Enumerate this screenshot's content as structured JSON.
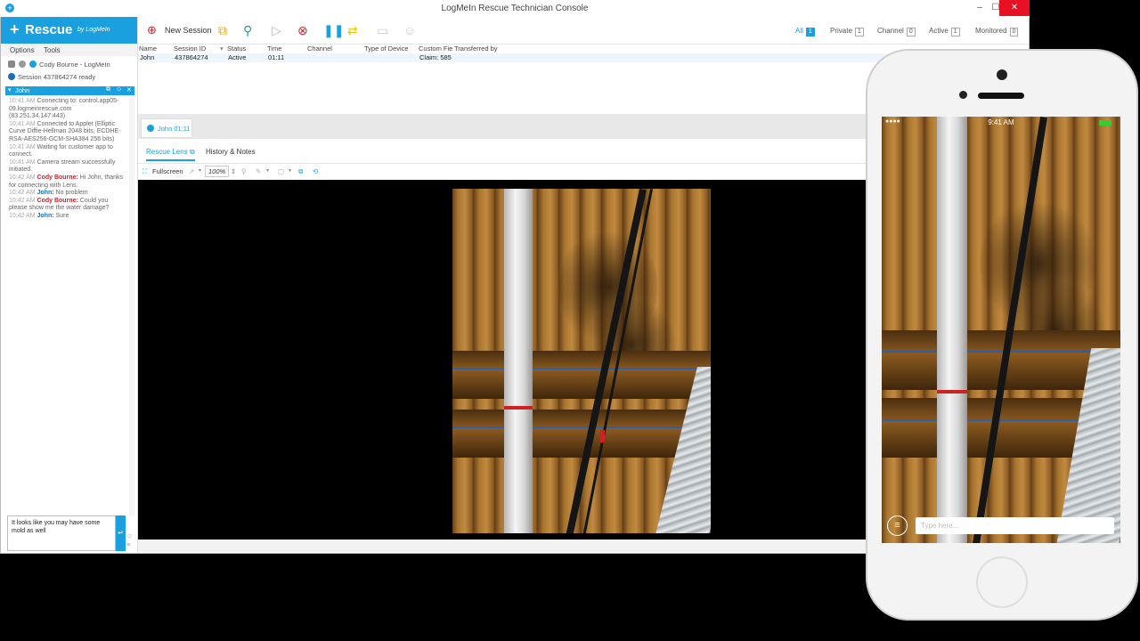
{
  "window": {
    "title": "LogMeIn Rescue Technician Console"
  },
  "brand": {
    "name": "Rescue",
    "by": "by LogMeIn"
  },
  "menu": [
    "Options",
    "Tools"
  ],
  "technician": "Cody Bourne - LogMeIn",
  "session_status": "Session 437864274 ready",
  "chat": {
    "tab_name": "John",
    "lines": [
      {
        "time": "10:41 AM",
        "who": "",
        "text": "Connecting to: control.app05-09.logmeinrescue.com (83.251.34.147:443)"
      },
      {
        "time": "10:41 AM",
        "who": "",
        "text": "Connected to Applet (Elliptic Curve Diffie-Hellman 2048 bits, ECDHE-RSA-AES256-GCM-SHA384 256 bits)"
      },
      {
        "time": "10:41 AM",
        "who": "",
        "text": "Waiting for customer app to connect."
      },
      {
        "time": "10:41 AM",
        "who": "",
        "text": "Camera stream successfully initiated."
      },
      {
        "time": "10:42 AM",
        "who": "Cody Bourne:",
        "text": "Hi John, thanks for connecting with Lens."
      },
      {
        "time": "10:42 AM",
        "who": "John:",
        "text": "No problem"
      },
      {
        "time": "10:42 AM",
        "who": "Cody Bourne:",
        "text": "Could you please show me the water damage?"
      },
      {
        "time": "10:42 AM",
        "who": "John:",
        "text": "Sure"
      }
    ],
    "input_value": "It looks like you may have some mold as well"
  },
  "toolbar": {
    "new_session": "New Session",
    "filters": [
      {
        "label": "All",
        "count": "1",
        "active": true
      },
      {
        "label": "Private",
        "count": "1",
        "active": false
      },
      {
        "label": "Channel",
        "count": "0",
        "active": false
      },
      {
        "label": "Active",
        "count": "1",
        "active": false
      },
      {
        "label": "Monitored",
        "count": "0",
        "active": false
      }
    ]
  },
  "session_table": {
    "headers": [
      "Name",
      "Session ID",
      "Status",
      "Time",
      "Channel",
      "Type of Device",
      "Custom Fie",
      "Transferred by"
    ],
    "row": {
      "name": "John",
      "session_id": "437864274",
      "status": "Active",
      "time": "01:11",
      "channel": "",
      "device": "",
      "custom": "Claim: 585",
      "transferred": ""
    }
  },
  "session_tab": "John 01:11",
  "subtabs": [
    "Rescue Lens",
    "History & Notes"
  ],
  "lens_toolbar": {
    "fullscreen": "Fullscreen",
    "zoom": "100%"
  },
  "phone": {
    "time": "9:41 AM",
    "input_placeholder": "Type here..."
  }
}
